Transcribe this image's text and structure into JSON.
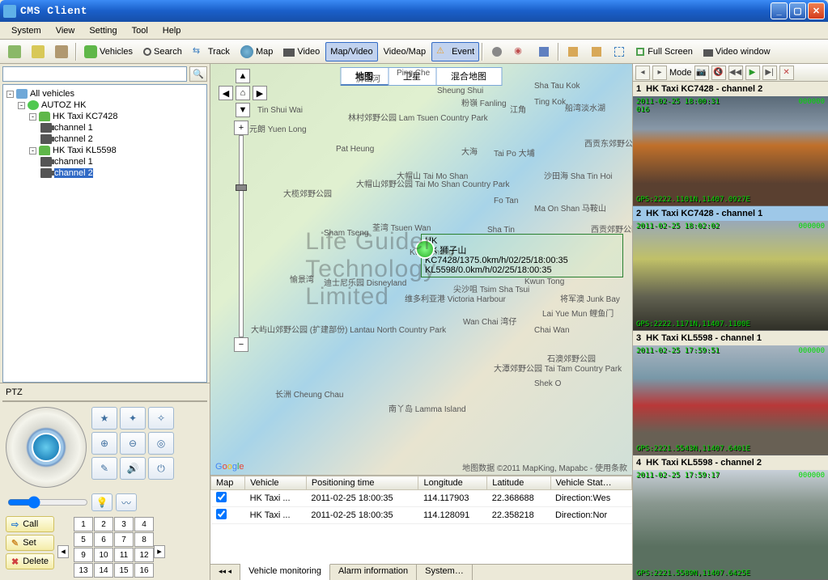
{
  "window": {
    "title": "CMS Client"
  },
  "menu": {
    "system": "System",
    "view": "View",
    "setting": "Setting",
    "tool": "Tool",
    "help": "Help"
  },
  "toolbar": {
    "vehicles": "Vehicles",
    "search": "Search",
    "track": "Track",
    "map": "Map",
    "video": "Video",
    "map_video": "Map/Video",
    "video_map": "Video/Map",
    "event": "Event",
    "fullscreen": "Full Screen",
    "videowindow": "Video window"
  },
  "tree": {
    "root": "All vehicles",
    "group": "AUTOZ HK",
    "v1": "HK Taxi KC7428",
    "v1c1": "channel 1",
    "v1c2": "channel 2",
    "v2": "HK Taxi KL5598",
    "v2c1": "channel 1",
    "v2c2": "channel 2"
  },
  "ptz": {
    "label": "PTZ",
    "call": "Call",
    "set": "Set",
    "delete": "Delete",
    "nums": [
      "1",
      "2",
      "3",
      "4",
      "5",
      "6",
      "7",
      "8",
      "9",
      "10",
      "11",
      "12",
      "13",
      "14",
      "15",
      "16"
    ]
  },
  "map": {
    "tab_map": "地图",
    "tab_sat": "卫星",
    "tab_hybrid": "混合地图",
    "attrib": "地图数据 ©2011 MapKing, Mapabc - 使用条款",
    "marker_l1": "HK",
    "marker_l2": "HK 狮子山",
    "marker_l3": "KC7428/1375.0km/h/02/25/18:00:35",
    "marker_l4": "KL5598/0.0km/h/02/25/18:00:35",
    "places": {
      "p1": "Ping Che",
      "p2": "屏山河",
      "p3": "Sheung Shui",
      "p4": "粉嶺 Fanling",
      "p5": "元朗 Yuen Long",
      "p6": "Tin Shui Wai",
      "p7": "林村郊野公园 Lam Tsuen Country Park",
      "p8": "江角",
      "p9": "Ting Kok",
      "p10": "船湾淡水湖",
      "p11": "大帽山郊野公园 Tai Mo Shan Country Park",
      "p12": "Pat Heung",
      "p13": "Tai Po 大埔",
      "p14": "大榄郊野公园",
      "p15": "大帽山 Tai Mo Shan",
      "p16": "Fo Tan",
      "p17": "Ma On Shan 马鞍山",
      "p18": "荃湾 Tsuen Wan",
      "p19": "Sham Tseng",
      "p20": "Kwai Chung",
      "p21": "Sha Tin",
      "p22": "西贡郊野公园",
      "p23": "迪士尼乐园 Disneyland",
      "p24": "愉景湾",
      "p25": "维多利亚港 Victoria Harbour",
      "p26": "尖沙咀 Tsim Sha Tsui",
      "p27": "Kwun Tong",
      "p28": "Lai Yue Mun 鲤鱼门",
      "p29": "将军澳 Junk Bay",
      "p30": "大屿山郊野公园 (扩建部份) Lantau North Country Park",
      "p31": "Wan Chai 湾仔",
      "p32": "长洲 Cheung Chau",
      "p33": "南丫岛 Lamma Island",
      "p34": "Chai Wan",
      "p35": "Shek O",
      "p36": "石澳郊野公园",
      "p37": "大潭郊野公园 Tai Tam Country Park",
      "p38": "西贡东郊野公园 Sai Kung",
      "p39": "Sha Tau Kok",
      "p40": "大海",
      "p41": "沙田海 Sha Tin Hoi"
    }
  },
  "watermark": "Life Guider Technology Limited",
  "table": {
    "h_map": "Map",
    "h_vehicle": "Vehicle",
    "h_time": "Positioning time",
    "h_lon": "Longitude",
    "h_lat": "Latitude",
    "h_stat": "Vehicle Stat…",
    "rows": [
      {
        "vehicle": "HK Taxi ...",
        "time": "2011-02-25 18:00:35",
        "lon": "114.117903",
        "lat": "22.368688",
        "stat": "Direction:Wes"
      },
      {
        "vehicle": "HK Taxi ...",
        "time": "2011-02-25 18:00:35",
        "lon": "114.128091",
        "lat": "22.358218",
        "stat": "Direction:Nor"
      }
    ],
    "tab_monitor": "Vehicle monitoring",
    "tab_alarm": "Alarm information",
    "tab_system": "System…"
  },
  "video": {
    "mode_label": "Mode",
    "panels": [
      {
        "num": "1",
        "title": "HK Taxi KC7428 - channel 2",
        "ts": "2011-02-25 18:00:31",
        "rec": "016",
        "tr": "000000",
        "gps": "GPS:2222.1101N,11407.0927E"
      },
      {
        "num": "2",
        "title": "HK Taxi KC7428 - channel 1",
        "ts": "2011-02-25 18:02:02",
        "rec": "",
        "tr": "000000",
        "gps": "GPS:2222.1171N,11407.1100E"
      },
      {
        "num": "3",
        "title": "HK Taxi KL5598 - channel 1",
        "ts": "2011-02-25 17:59:51",
        "rec": "",
        "tr": "000000",
        "gps": "GPS:2221.5543N,11407.6401E"
      },
      {
        "num": "4",
        "title": "HK Taxi KL5598 - channel 2",
        "ts": "2011-02-25 17:59:17",
        "rec": "",
        "tr": "000000",
        "gps": "GPS:2221.5589N,11407.6425E"
      }
    ]
  }
}
